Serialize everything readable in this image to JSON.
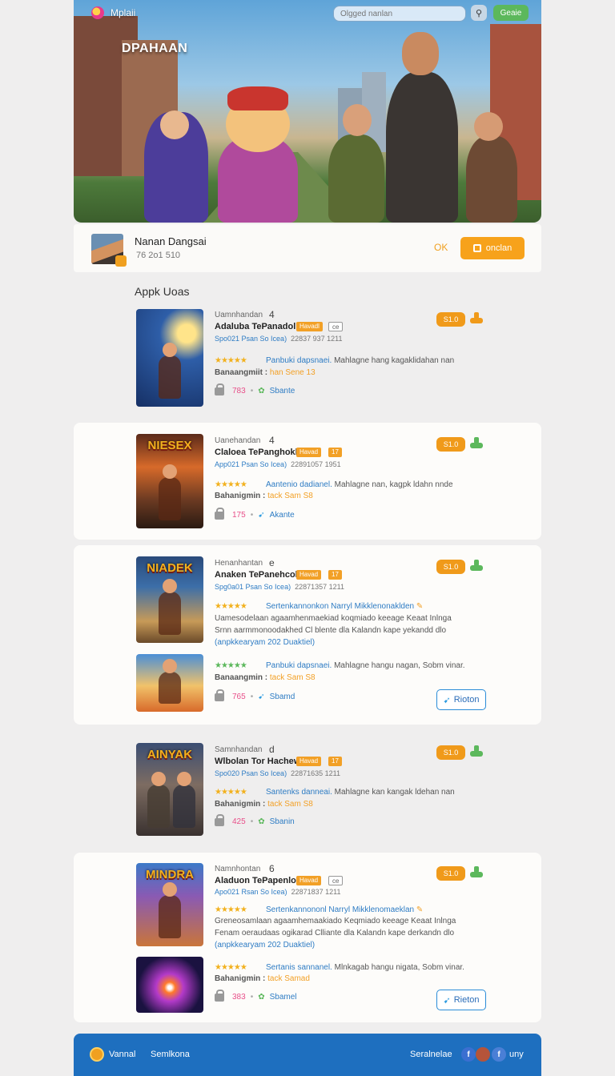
{
  "header": {
    "brand": "Mplaii",
    "hero_title": "DPAHAAN",
    "search_placeholder": "Olgged nanlan",
    "search_icon": "search-icon",
    "cta": "Geaie"
  },
  "profile": {
    "name": "Nanan Dangsai",
    "meta": "76 2o1 510",
    "ok": "OK",
    "button": "onclan"
  },
  "section_title": "Appk Uoas",
  "games": [
    {
      "thumb_title": "",
      "category": "Uamnhandan",
      "num": "4",
      "name": "Adaluba TePanadolk",
      "badge1": "Havadl",
      "badge2": "ce",
      "info": "Spo021 Psan So Icea)",
      "info2": "22837 937 1211",
      "highlight": "Panbuki dapsnaei.",
      "desc": "Mahlagne hang kagaklidahan nan",
      "tag_prefix": "Banaangmiit :",
      "tag": "han Sene 13",
      "count": "783",
      "label": "Sbante",
      "price": "S1.0"
    },
    {
      "thumb_title": "NIESEX",
      "category": "Uanehandan",
      "num": "4",
      "name": "Claloea TePanghoklc",
      "badge1": "Havad",
      "badge2": "17",
      "info": "App021 Psan So Icea)",
      "info2": "22891057 1951",
      "highlight": "Aantenio dadianel.",
      "desc": "Mahlagne nan, kagpk ldahn nnde",
      "tag_prefix": "Bahanigmin :",
      "tag": "tack Sam S8",
      "count": "175",
      "label": "Akante",
      "price": "S1.0"
    },
    {
      "thumb_title": "NIADEK",
      "category": "Henanhantan",
      "num": "e",
      "name": "Anaken TePanehcok",
      "badge1": "Havad",
      "badge2": "17",
      "info": "Spg0a01 Psan So Icea)",
      "info2": "22871357 1211",
      "highlight": "Sertenkannonkon Narryl Mikklenonaklden",
      "long1": "Uamesodelaan agaamhenmaekiad  koqmiado keeage  Keaat  Inlnga",
      "long2": "Srnn aarmmonoodakhed Cl blente dla  Kalandn kape yekandd dlo",
      "long3": "(anpkkearyam 202 Duaktiel)",
      "price": "S1.0"
    },
    {
      "thumb_title": "",
      "highlight": "Panbuki dapsnaei.",
      "desc": "Mahlagne hangu nagan, Sobm vinar.",
      "tag_prefix": "Banaangmin :",
      "tag": "tack Sam S8",
      "count": "765",
      "label": "Sbamd",
      "button": "Rioton"
    },
    {
      "thumb_title": "AINYAK",
      "category": "Samnhandan",
      "num": "d",
      "name": "Wlbolan Tor Hachew",
      "badge1": "Havad",
      "badge2": "17",
      "info": "Spo020 Psan So Icea)",
      "info2": "22871635 1211",
      "highlight": "Santenks danneai.",
      "desc": "Mahlagne kan kangak ldehan nan",
      "tag_prefix": "Bahanigmin :",
      "tag": "tack Sam S8",
      "count": "425",
      "label": "Sbanin",
      "price": "S1.0"
    },
    {
      "thumb_title": "MINDRA",
      "category": "Namnhontan",
      "num": "6",
      "name": "Aladuon TePapenlon",
      "badge1": "Havad",
      "badge2": "ce",
      "info": "Apo021 Rsan So Icea)",
      "info2": "22871837 1211",
      "highlight": "Sertenkannononl Narryl Mikklenomaeklan",
      "long1": "Greneosamlaan agaamhemaakiado  Keqmiado keeage  Keaat  Inlnga",
      "long2": "Fenam  oeraudaas ogikarad  Clliante dla  Kalandn kape derkandn dlo",
      "long3": "(anpkkearyam 202 Duaktiel)",
      "price": "S1.0"
    },
    {
      "thumb_title": "",
      "highlight": "Sertanis sannanel.",
      "desc": "Mlnkagab hangu nigata, Sobm vinar.",
      "tag_prefix": "Bahanigmin :",
      "tag": "tack Samad",
      "count": "383",
      "label": "Sbamel",
      "button": "Rieton"
    }
  ],
  "footer": {
    "left1": "Vannal",
    "left2": "Semlkona",
    "right1": "Seralnelae",
    "right2": "uny",
    "social1": "f",
    "social2": "f",
    "brand_color": "#1e6fbf"
  },
  "colors": {
    "accent": "#f7a21b",
    "link": "#2e7cc4",
    "green": "#5cb85c"
  }
}
